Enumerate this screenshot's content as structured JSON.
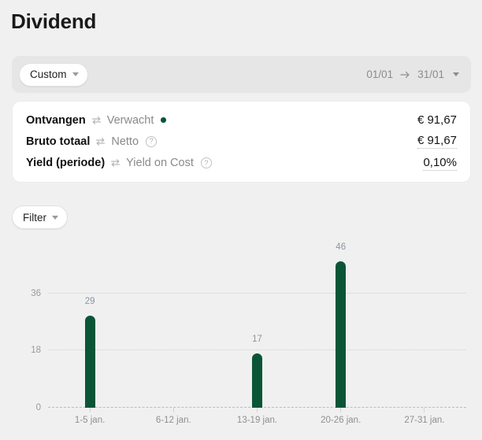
{
  "page": {
    "title": "Dividend",
    "background": "#f0f0f0",
    "accent_green": "#0b5537"
  },
  "date_toolbar": {
    "preset_label": "Custom",
    "start_date": "01/01",
    "arrow_glyph": "→",
    "end_date": "31/01"
  },
  "summary": {
    "rows": [
      {
        "active_label": "Ontvangen",
        "inactive_label": "Verwacht",
        "indicator": "green-dot",
        "value": "€ 91,67",
        "value_dotted": false
      },
      {
        "active_label": "Bruto totaal",
        "inactive_label": "Netto",
        "indicator": "help",
        "value": "€ 91,67",
        "value_dotted": true
      },
      {
        "active_label": "Yield (periode)",
        "inactive_label": "Yield on Cost",
        "indicator": "help",
        "value": "0,10%",
        "value_dotted": true
      }
    ]
  },
  "filter": {
    "label": "Filter"
  },
  "chart_data": {
    "type": "bar",
    "title": "",
    "xlabel": "",
    "ylabel": "",
    "categories": [
      "1-5 jan.",
      "6-12 jan.",
      "13-19 jan.",
      "20-26 jan.",
      "27-31 jan."
    ],
    "values": [
      29,
      null,
      17,
      46,
      null
    ],
    "value_labels": [
      "29",
      "",
      "17",
      "46",
      ""
    ],
    "yticks": [
      0,
      18,
      36
    ],
    "ytick_labels": [
      "0",
      "18",
      "36"
    ],
    "ylim": [
      0,
      52
    ],
    "grid": true,
    "legend": "none",
    "bar_color": "#0b5537"
  }
}
